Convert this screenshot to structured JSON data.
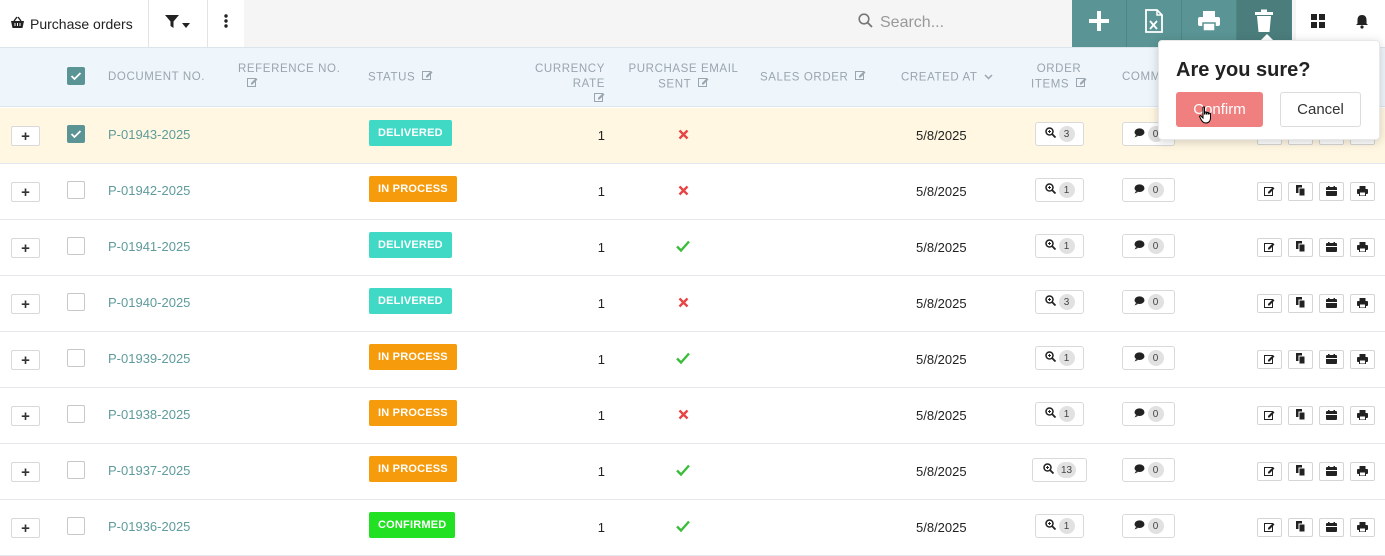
{
  "header": {
    "title": "Purchase orders",
    "title_icon": "basket-icon",
    "filter_icon": "filter-icon",
    "more_icon": "vertical-dots-icon",
    "search_placeholder": "Search...",
    "actions": [
      "add-icon",
      "excel-icon",
      "print-icon",
      "trash-icon"
    ],
    "right_icons": [
      "dashboard-icon",
      "bell-icon"
    ]
  },
  "colors": {
    "accent": "#5a9494",
    "link": "#5f9b9b",
    "delivered": "#3fd9c6",
    "in_process": "#f59b0c",
    "confirmed": "#22e022",
    "check": "#3bbd3b",
    "cross": "#e64545",
    "selected_row": "#fff7e1",
    "confirm_button": "#f08080"
  },
  "columns": {
    "document_no": "DOCUMENT NO.",
    "reference_no": "REFERENCE NO.",
    "status": "STATUS",
    "currency_rate": "CURRENCY RATE",
    "purchase_email_sent_1": "PURCHASE EMAIL",
    "purchase_email_sent_2": "SENT",
    "sales_order": "SALES ORDER",
    "created_at": "CREATED AT",
    "order_items_1": "ORDER",
    "order_items_2": "ITEMS",
    "comments": "COMM"
  },
  "rows": [
    {
      "doc": "P-01943-2025",
      "status": "DELIVERED",
      "status_color": "#3fd9c6",
      "rate": "1",
      "email_sent": false,
      "created": "5/8/2025",
      "items": "3",
      "comments": "0",
      "selected": true
    },
    {
      "doc": "P-01942-2025",
      "status": "IN PROCESS",
      "status_color": "#f59b0c",
      "rate": "1",
      "email_sent": false,
      "created": "5/8/2025",
      "items": "1",
      "comments": "0",
      "selected": false
    },
    {
      "doc": "P-01941-2025",
      "status": "DELIVERED",
      "status_color": "#3fd9c6",
      "rate": "1",
      "email_sent": true,
      "created": "5/8/2025",
      "items": "1",
      "comments": "0",
      "selected": false
    },
    {
      "doc": "P-01940-2025",
      "status": "DELIVERED",
      "status_color": "#3fd9c6",
      "rate": "1",
      "email_sent": false,
      "created": "5/8/2025",
      "items": "3",
      "comments": "0",
      "selected": false
    },
    {
      "doc": "P-01939-2025",
      "status": "IN PROCESS",
      "status_color": "#f59b0c",
      "rate": "1",
      "email_sent": true,
      "created": "5/8/2025",
      "items": "1",
      "comments": "0",
      "selected": false
    },
    {
      "doc": "P-01938-2025",
      "status": "IN PROCESS",
      "status_color": "#f59b0c",
      "rate": "1",
      "email_sent": false,
      "created": "5/8/2025",
      "items": "1",
      "comments": "0",
      "selected": false
    },
    {
      "doc": "P-01937-2025",
      "status": "IN PROCESS",
      "status_color": "#f59b0c",
      "rate": "1",
      "email_sent": true,
      "created": "5/8/2025",
      "items": "13",
      "comments": "0",
      "selected": false
    },
    {
      "doc": "P-01936-2025",
      "status": "CONFIRMED",
      "status_color": "#22e022",
      "rate": "1",
      "email_sent": true,
      "created": "5/8/2025",
      "items": "1",
      "comments": "0",
      "selected": false
    }
  ],
  "row_action_icons": [
    "edit-icon",
    "copy-icon",
    "calendar-icon",
    "print-icon"
  ],
  "popover": {
    "title": "Are you sure?",
    "confirm_label": "Confirm",
    "cancel_label": "Cancel"
  }
}
